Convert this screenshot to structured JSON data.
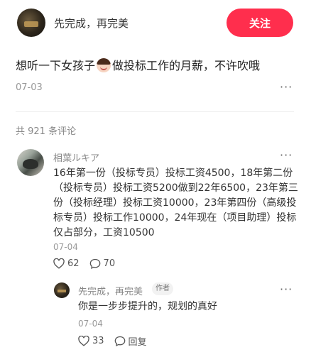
{
  "header": {
    "author_name": "先完成，再完美",
    "follow_label": "关注"
  },
  "post": {
    "title_before": "想听一下女孩子",
    "title_emoji": "girl-face-emoji",
    "title_after": "做投标工作的月薪，不许吹哦",
    "date": "07-03",
    "more": "···"
  },
  "comments": {
    "count_label": "共 921 条评论",
    "items": [
      {
        "user": "相葉ルキア",
        "text": "16年第一份（投标专员）投标工资4500，18年第二份（投标专员）投标工资5200做到22年6500，23年第三份（投标经理）投标工资10000，23年第四份（高级投标专员）投标工作10000，24年现在（项目助理）投标仅占部分，工资10500",
        "date": "07-04",
        "likes": "62",
        "replies": "70",
        "more": "···",
        "reply": {
          "user": "先完成，再完美",
          "badge": "作者",
          "text": "你是一步步提升的，规划的真好",
          "date": "07-04",
          "likes": "33",
          "reply_label": "回复",
          "more": "···"
        }
      }
    ]
  },
  "colors": {
    "accent": "#ff2e4d",
    "muted_text": "#999999",
    "body_text": "#333333"
  }
}
